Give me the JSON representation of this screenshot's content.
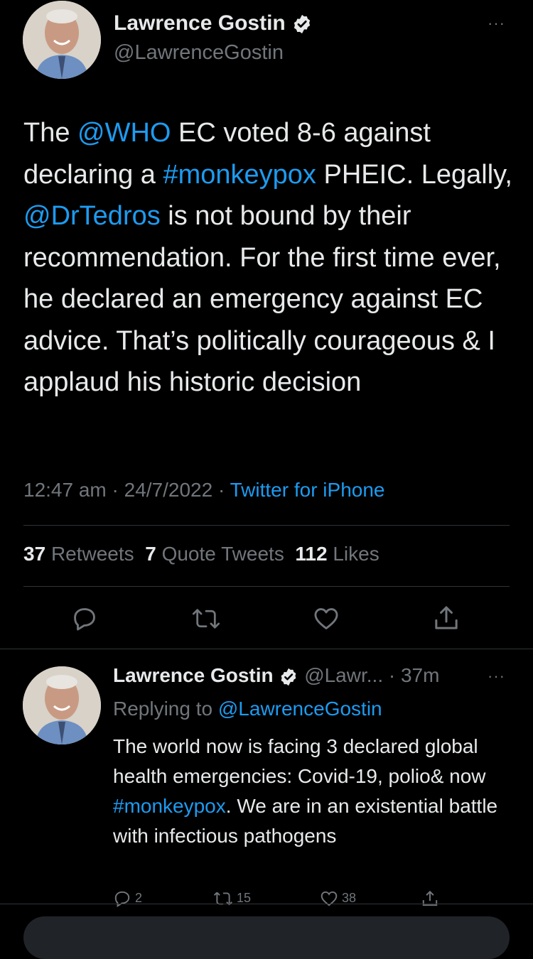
{
  "tweet": {
    "author_name": "Lawrence Gostin",
    "author_handle": "@LawrenceGostin",
    "text_parts": [
      "The ",
      "@WHO",
      " EC voted 8-6 against declaring a ",
      "#monkeypox",
      " PHEIC. Legally, ",
      "@DrTedros",
      " is not bound by their recommendation. For the first time ever, he declared an emergency against EC advice. That’s politically courageous & I applaud his historic decision"
    ],
    "time": "12:47 am",
    "date": "24/7/2022",
    "source": "Twitter for iPhone",
    "retweets_count": "37",
    "retweets_label": "Retweets",
    "quotes_count": "7",
    "quotes_label": "Quote Tweets",
    "likes_count": "112",
    "likes_label": "Likes",
    "more": "···",
    "sep": "·"
  },
  "reply": {
    "author_name": "Lawrence Gostin",
    "author_handle": "@Lawr...",
    "age": "· 37m",
    "replying_prefix": "Replying to ",
    "replying_handle": "@LawrenceGostin",
    "text_before": "The world now is facing 3 declared global health emergencies: Covid-19, polio& now ",
    "hashtag": "#monkeypox",
    "text_after": ". We are in an existential battle with infectious pathogens",
    "reply_count": "2",
    "retweet_count": "15",
    "like_count": "38",
    "more": "···"
  },
  "colors": {
    "link": "#1d9bf0",
    "muted": "#71767b",
    "text": "#e7e9ea",
    "background": "#000000"
  }
}
